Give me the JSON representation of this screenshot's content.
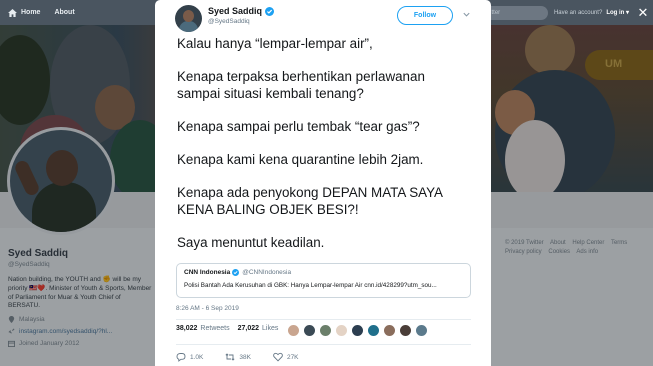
{
  "topnav": {
    "home_label": "Home",
    "about_label": "About",
    "search_placeholder": "Search Twitter",
    "account_question": "Have an account?",
    "login_label": "Log in ▾"
  },
  "profile": {
    "name": "Syed Saddiq",
    "handle": "@SyedSaddiq",
    "bio": "Nation building, the YOUTH and ✊ will be my priority 🇲🇾❤️. Minister of Youth & Sports, Member of Parliament for Muar & Youth Chief of BERSATU.",
    "location": "Malaysia",
    "link": "instagram.com/syedsaddiq/?hl...",
    "joined": "Joined January 2012"
  },
  "footer": {
    "links": [
      "© 2019 Twitter",
      "About",
      "Help Center",
      "Terms",
      "Privacy policy",
      "Cookies",
      "Ads info"
    ]
  },
  "tweet": {
    "author_name": "Syed Saddiq",
    "author_handle": "@SyedSaddiq",
    "follow_label": "Follow",
    "paragraphs": [
      "Kalau hanya “lempar-lempar air”,",
      "Kenapa terpaksa berhentikan perlawanan\nsampai situasi kembali tenang?",
      "Kenapa sampai perlu tembak “tear gas”?",
      "Kenapa kami kena quarantine lebih 2jam.",
      "Kenapa ada penyokong DEPAN MATA SAYA\nKENA BALING OBJEK BESI?!",
      "Saya menuntut keadilan."
    ],
    "quote": {
      "name": "CNN Indonesia",
      "handle": "@CNNIndonesia",
      "text": "Polisi Bantah Ada Kerusuhan di GBK: Hanya Lempar-lempar Air cnn.id/428299?utm_sou..."
    },
    "timestamp": "8:26 AM - 6 Sep 2019",
    "retweets_count": "38,022",
    "retweets_label": "Retweets",
    "likes_count": "27,022",
    "likes_label": "Likes",
    "liker_colors": [
      "#c9a58f",
      "#3b4a55",
      "#6b7f6a",
      "#e4d3c5",
      "#2c3e50",
      "#1f6f8b",
      "#8a6d5c",
      "#4a3d38",
      "#5b7a8c"
    ],
    "reply_count": "1.0K",
    "retweet_action_count": "38K",
    "like_action_count": "27K"
  },
  "colors": {
    "accent": "#1da1f2",
    "nav_bg": "#4a5560",
    "verified": "#1da1f2"
  }
}
